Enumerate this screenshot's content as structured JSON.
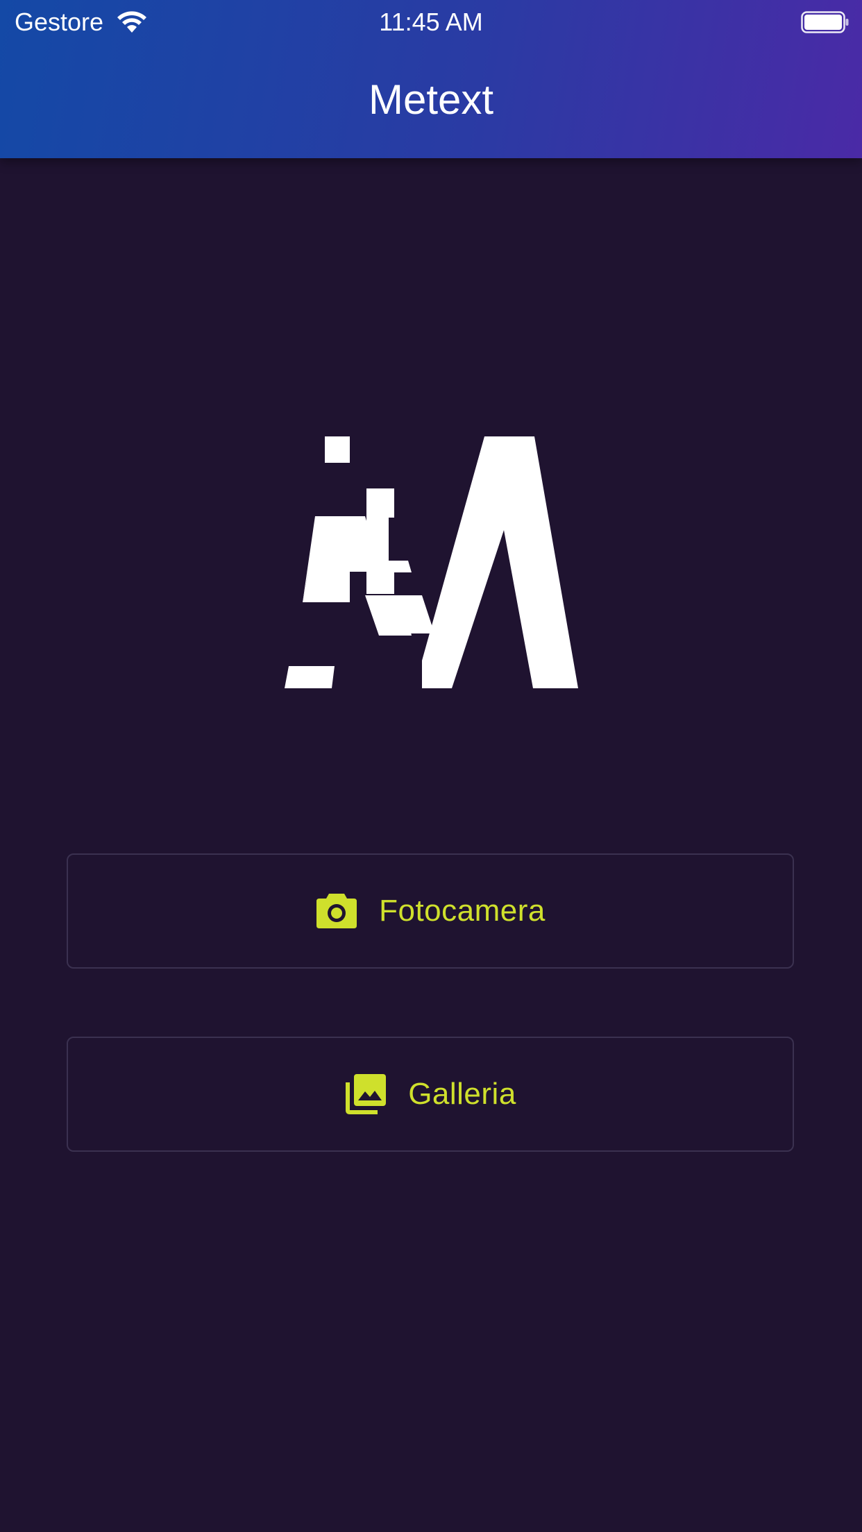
{
  "status_bar": {
    "carrier": "Gestore",
    "time": "11:45 AM"
  },
  "app_bar": {
    "title": "Metext"
  },
  "actions": {
    "camera_label": "Fotocamera",
    "gallery_label": "Galleria"
  },
  "icons": {
    "wifi": "wifi-icon",
    "battery": "battery-icon",
    "camera": "camera-icon",
    "gallery": "photo-library-icon",
    "logo": "metext-logo"
  },
  "colors": {
    "background": "#1f1330",
    "header_gradient_start": "#1449a6",
    "header_gradient_end": "#4a2aa6",
    "accent": "#cfe02c",
    "button_border": "#3b3150",
    "logo": "#ffffff"
  }
}
